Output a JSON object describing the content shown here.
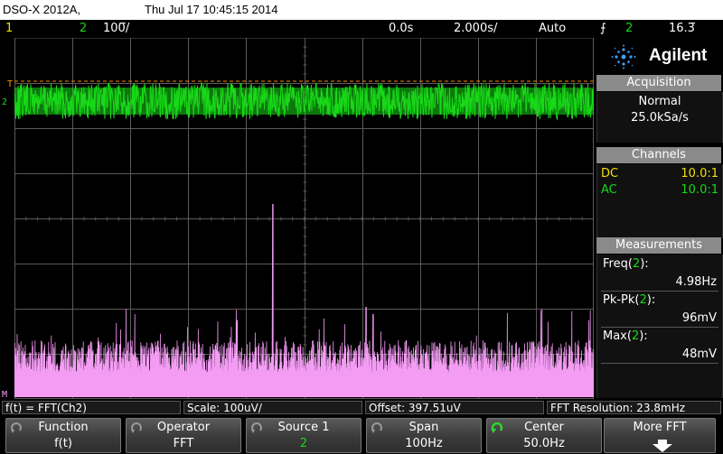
{
  "title": {
    "model": "DSO-X 2012A,",
    "datetime": "Thu Jul 17 10:45:15 2014"
  },
  "status": {
    "ch1_label": "1",
    "ch2_label": "2",
    "ch2_scale": "100̅/",
    "time_delay": "0.0s",
    "time_scale": "2.000s/",
    "trigger_mode": "Auto",
    "trigger_source": "2",
    "trigger_level": "16.3̅"
  },
  "colors": {
    "ch1": "#f0e000",
    "ch2": "#18d818",
    "math": "#f49cf4",
    "trigger": "#ff8c00",
    "grid": "#5a5a5a"
  },
  "markers": {
    "trigger_level": "T",
    "ch2_ground": "2",
    "math_ground": "M"
  },
  "panel": {
    "brand": "Agilent",
    "acquisition": {
      "title": "Acquisition",
      "mode": "Normal",
      "rate": "25.0kSa/s"
    },
    "channels": {
      "title": "Channels",
      "rows": [
        {
          "coupling": "DC",
          "probe": "10.0:1",
          "color": "#f0e000"
        },
        {
          "coupling": "AC",
          "probe": "10.0:1",
          "color": "#18d818"
        }
      ]
    },
    "measurements": {
      "title": "Measurements",
      "items": [
        {
          "name": "Freq(",
          "ch": "2",
          "close": "):",
          "value": "4.98Hz"
        },
        {
          "name": "Pk-Pk(",
          "ch": "2",
          "close": "):",
          "value": "96mV"
        },
        {
          "name": "Max(",
          "ch": "2",
          "close": "):",
          "value": "48mV"
        }
      ]
    }
  },
  "infobar": {
    "function": "f(t) = FFT(Ch2)",
    "scale": "Scale: 100uV/",
    "offset": "Offset: 397.51uV",
    "resolution": "FFT Resolution: 23.8mHz"
  },
  "softkeys": [
    {
      "title": "Function",
      "value": "f(t)"
    },
    {
      "title": "Operator",
      "value": "FFT"
    },
    {
      "title": "Source 1",
      "value": "2"
    },
    {
      "title": "Span",
      "value": "100Hz"
    },
    {
      "title": "Center",
      "value": "50.0Hz"
    },
    {
      "title": "More FFT",
      "value": ""
    }
  ]
}
